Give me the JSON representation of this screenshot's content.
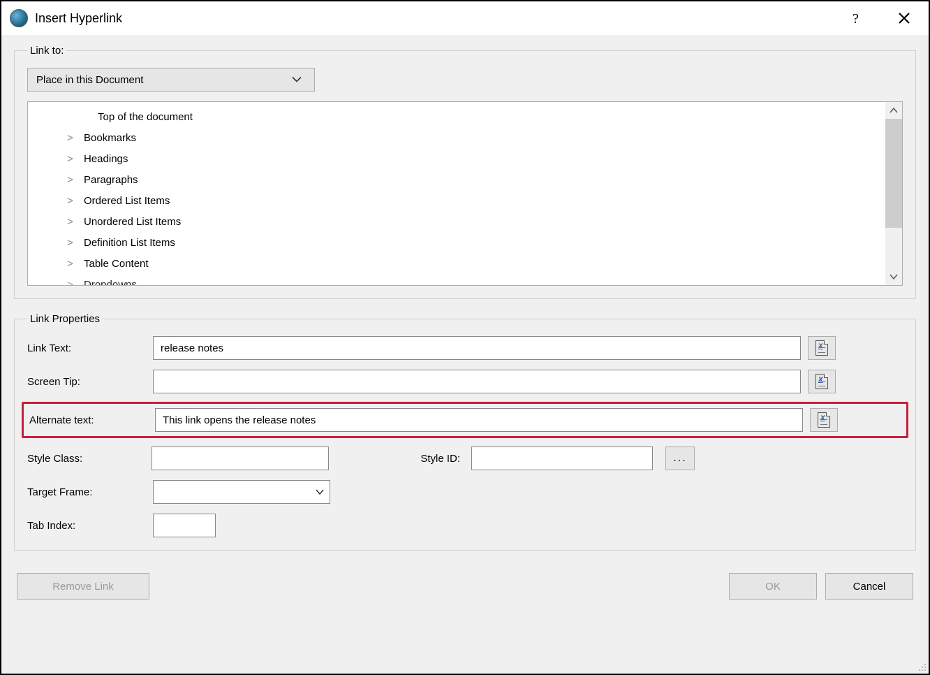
{
  "title": "Insert Hyperlink",
  "linkto": {
    "legend": "Link to:",
    "selected": "Place in this Document",
    "tree": [
      {
        "expand": "",
        "label": "Top of the document",
        "first": true
      },
      {
        "expand": ">",
        "label": "Bookmarks"
      },
      {
        "expand": ">",
        "label": "Headings"
      },
      {
        "expand": ">",
        "label": "Paragraphs"
      },
      {
        "expand": ">",
        "label": "Ordered List Items"
      },
      {
        "expand": ">",
        "label": "Unordered List Items"
      },
      {
        "expand": ">",
        "label": "Definition List Items"
      },
      {
        "expand": ">",
        "label": "Table Content"
      },
      {
        "expand": ">",
        "label": "Dropdowns"
      }
    ]
  },
  "props": {
    "legend": "Link Properties",
    "rows": {
      "linktext_label": "Link Text:",
      "linktext_value": "release notes",
      "screentip_label": "Screen Tip:",
      "screentip_value": "",
      "alttext_label": "Alternate text:",
      "alttext_value": "This link opens the release notes",
      "styleclass_label": "Style Class:",
      "styleclass_value": "",
      "styleid_label": "Style ID:",
      "styleid_value": "",
      "targetframe_label": "Target Frame:",
      "targetframe_value": "",
      "tabindex_label": "Tab Index:",
      "tabindex_value": ""
    },
    "dots": "..."
  },
  "buttons": {
    "remove": "Remove Link",
    "ok": "OK",
    "cancel": "Cancel"
  }
}
